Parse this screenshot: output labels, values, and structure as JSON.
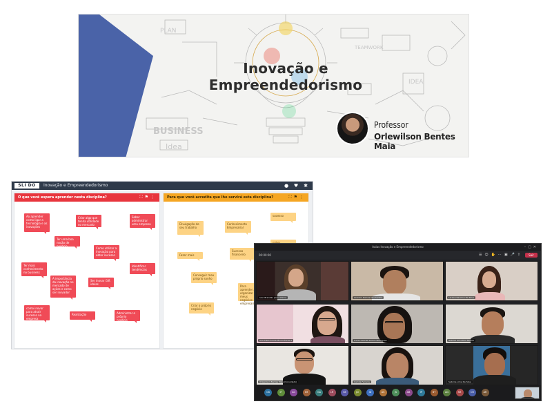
{
  "banner": {
    "title": "Inovação e Empreendedorismo",
    "professor_label": "Professor",
    "professor_name": "Orlewilson Bentes Maia",
    "accent_color": "#4a63a8"
  },
  "slido": {
    "logo": "SLI DO",
    "app_title": "Inovação e Empreendedorismo",
    "top_icons": [
      "drop-icon",
      "heart-icon",
      "gear-icon"
    ],
    "column1": {
      "question": "O que você espera aprender nesta disciplina?",
      "color": "#e8353d",
      "notes": [
        "Ao aprender como ligar a tecnologia e as inovações",
        "Criar algo que tenha utilidade no mercado",
        "Saber administrar uma empresa",
        "Ter uma boa noção de negócio",
        "Como utilizar a inovação para obter sucesso",
        "Ter mais conhecimento no business",
        "A importância da inovação no mercado de ações e como ser inovador",
        "Ser inovar Gift ideias",
        "Identificar tendências",
        "como inovar para atrair sucesso na empresa",
        "Realização",
        "Administrar o próprio negócio"
      ]
    },
    "column2": {
      "question": "Para que você acredita que lhe servirá esta disciplina?",
      "color": "#f5a623",
      "notes": [
        "sucesso",
        "Divulgação do seu trabalho",
        "Conhecimento Empresarial",
        "saber administrar",
        "Fazer mais",
        "Sucesso financeiro",
        "Conseguir meu próprio sonho",
        "Para aprender a organizar meus negócios empresariais",
        "Criar o próprio negócio"
      ]
    }
  },
  "meeting": {
    "window_title": "Aulas Inovação e Empreendedorismo",
    "toolbar_left": "00:00:00",
    "leave_label": "Sair",
    "participants": [
      {
        "name": "Ivan Brandão (Convidado)"
      },
      {
        "name": "Leandro Ramos Dos Santos"
      },
      {
        "name": "Larissa Karoline Da Silva"
      },
      {
        "name": "Ana Clara Souza Moura Ferreira"
      },
      {
        "name": "Lucas Gabriel Santos Rodrigues"
      },
      {
        "name": "Gabriel Lima Dos Santos"
      },
      {
        "name": "Orlewilson Bentes Maia (Convidado)"
      },
      {
        "name": "Camila Ferreira"
      },
      {
        "name": "Sabrina Lima Da Silva"
      }
    ],
    "bubble_initials": [
      "CB",
      "IF",
      "AC",
      "IM",
      "GA",
      "LR",
      "SE",
      "JD",
      "ID",
      "AS",
      "JS",
      "AB",
      "IP",
      "BT",
      "AG",
      "SR",
      "CR",
      "AR"
    ],
    "bubble_colors": [
      "#2b6f9e",
      "#5f8d3a",
      "#8a4b9c",
      "#a0623a",
      "#3a7d7d",
      "#9c4b5d",
      "#5a5aa8",
      "#7a8a2f",
      "#3d6fbf",
      "#b0743a",
      "#4d8e5a",
      "#8b4a8b",
      "#2f7a9a",
      "#9a5a2f",
      "#5b7f3f",
      "#a84a4a",
      "#4a5ea8",
      "#7a5a3a"
    ]
  }
}
